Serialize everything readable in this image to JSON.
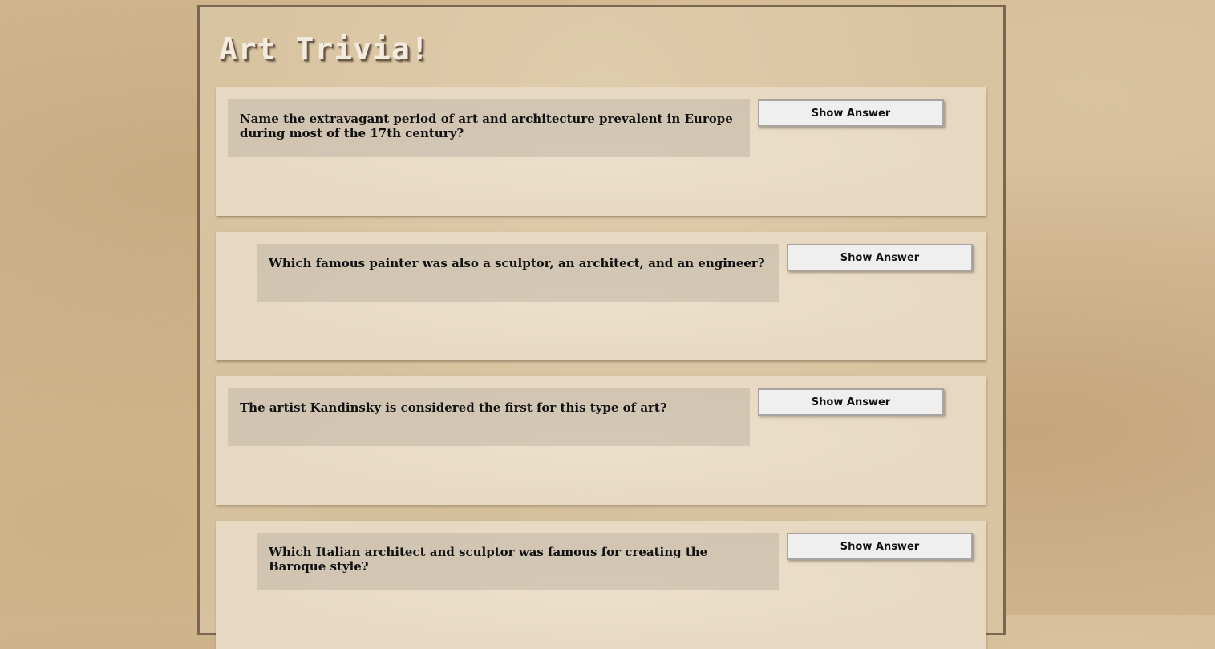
{
  "page": {
    "title": "Art Trivia!"
  },
  "questions": [
    {
      "text": "Name the extravagant period of art and architecture prevalent in Europe during most of the 17th century?",
      "button_label": "Show Answer"
    },
    {
      "text": "Which famous painter was also a sculptor, an architect, and an engineer?",
      "button_label": "Show Answer"
    },
    {
      "text": "The artist Kandinsky is considered the first for this type of art?",
      "button_label": "Show Answer"
    },
    {
      "text": "Which Italian architect and sculptor was famous for creating the Baroque style?",
      "button_label": "Show Answer"
    }
  ]
}
